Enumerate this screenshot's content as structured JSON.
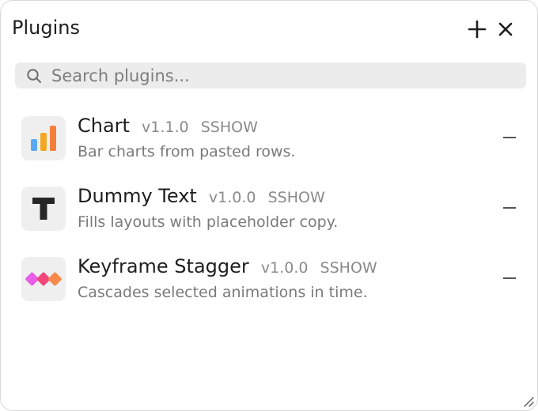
{
  "header": {
    "title": "Plugins",
    "add_icon": "plus-icon",
    "close_icon": "close-icon"
  },
  "search": {
    "placeholder": "Search plugins...",
    "value": "",
    "icon": "search-icon"
  },
  "plugins": [
    {
      "name": "Chart",
      "version": "v1.1.0",
      "author": "SSHOW",
      "description": "Bar charts from pasted rows.",
      "icon": "bar-chart-icon",
      "colors": [
        "#5aa9f5",
        "#f5a623",
        "#f57f3a"
      ]
    },
    {
      "name": "Dummy Text",
      "version": "v1.0.0",
      "author": "SSHOW",
      "description": "Fills layouts with placeholder copy.",
      "icon": "text-t-icon",
      "colors": [
        "#262626"
      ]
    },
    {
      "name": "Keyframe Stagger",
      "version": "v1.0.0",
      "author": "SSHOW",
      "description": "Cascades selected animations in time.",
      "icon": "keyframes-icon",
      "colors": [
        "#e85ee6",
        "#f0467a",
        "#f78a4a"
      ]
    }
  ],
  "remove_icon": "minus-icon",
  "resize_icon": "resize-grip-icon"
}
